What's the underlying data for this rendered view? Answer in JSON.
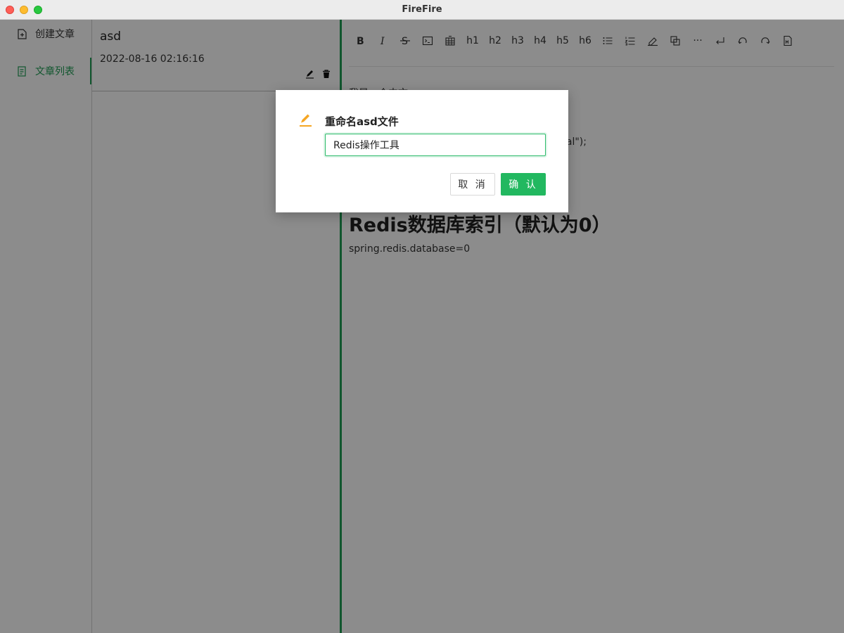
{
  "window": {
    "title": "FireFire"
  },
  "sidebar": {
    "items": [
      {
        "label": "创建文章",
        "icon": "file-add-icon"
      },
      {
        "label": "文章列表",
        "icon": "list-icon",
        "active": true
      }
    ]
  },
  "article_list": {
    "items": [
      {
        "title": "asd",
        "date": "2022-08-16 02:16:16"
      }
    ]
  },
  "editor": {
    "toolbar": [
      "B",
      "I",
      "S",
      "code",
      "table",
      "h1",
      "h2",
      "h3",
      "h4",
      "h5",
      "h6",
      "ul",
      "ol",
      "highlight",
      "copy",
      "···",
      "enter",
      "undo",
      "redo",
      "markdown"
    ],
    "toolbar_labels": {
      "h1": "h1",
      "h2": "h2",
      "h3": "h3",
      "h4": "h4",
      "h5": "h5",
      "h6": "h6",
      "more": "···"
    },
    "content": {
      "line1": "我是一个中文",
      "line2": "ual\");",
      "heading": "Redis数据库索引（默认为0）",
      "para": "spring.redis.database=0"
    }
  },
  "dialog": {
    "title": "重命名asd文件",
    "input_value": "Redis操作工具",
    "cancel_label": "取 消",
    "ok_label": "确 认",
    "icon": "edit-icon"
  },
  "colors": {
    "accent": "#22b860",
    "active_text": "#1f9d55",
    "warning_icon": "#f5a623"
  }
}
